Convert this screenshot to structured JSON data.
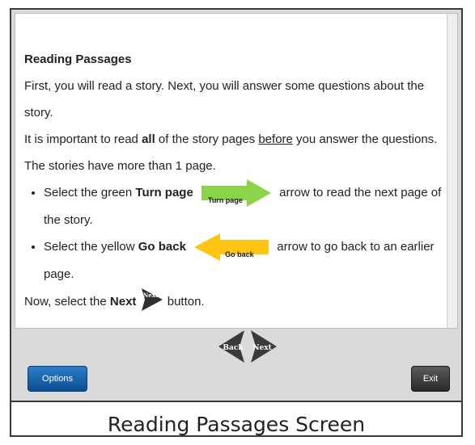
{
  "content": {
    "title": "Reading Passages",
    "para1": "First, you will read a story. Next, you will answer some questions about the story.",
    "para2": {
      "a": "It is important to read ",
      "b": "all",
      "c": " of the story pages ",
      "d": "before",
      "e": " you answer the questions. The stories have more than 1 page."
    },
    "bullets": [
      {
        "pre": "Select the green ",
        "bold": "Turn page",
        "arrow_label": "Turn page",
        "post": " arrow to read the next page of the story."
      },
      {
        "pre": "Select the yellow ",
        "bold": "Go back",
        "arrow_label": "Go back",
        "post": " arrow to go back to an earlier page."
      }
    ],
    "final": {
      "pre": "Now, select the ",
      "bold": "Next",
      "post": " button."
    }
  },
  "icons": {
    "next_inline_label": "Next"
  },
  "nav": {
    "back_label": "Back",
    "next_label": "Next"
  },
  "buttons": {
    "options": "Options",
    "exit": "Exit"
  },
  "caption": "Reading Passages Screen",
  "colors": {
    "turn_page": "#8bd44a",
    "go_back": "#ffc514",
    "options": "#0b4c8f",
    "exit": "#2a2a2a"
  }
}
